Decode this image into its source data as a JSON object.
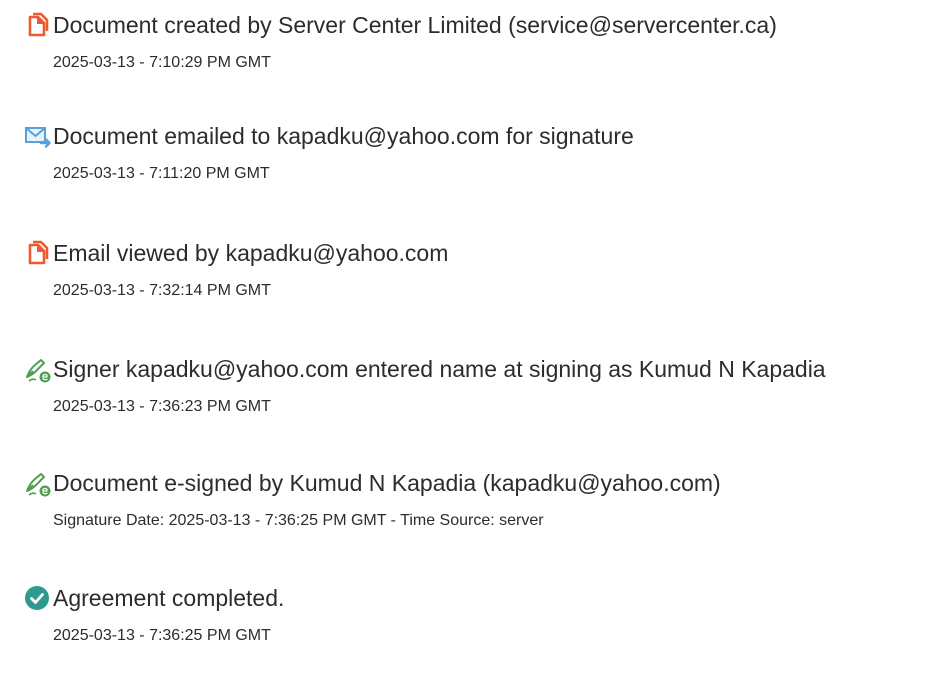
{
  "events": [
    {
      "icon": "document-created-icon",
      "title": "Document created by Server Center Limited (service@servercenter.ca)",
      "meta": "2025-03-13 - 7:10:29 PM GMT"
    },
    {
      "icon": "email-sent-icon",
      "title": "Document emailed to kapadku@yahoo.com for signature",
      "meta": "2025-03-13 - 7:11:20 PM GMT"
    },
    {
      "icon": "email-viewed-icon",
      "title": "Email viewed by kapadku@yahoo.com",
      "meta": "2025-03-13 - 7:32:14 PM GMT"
    },
    {
      "icon": "signer-name-icon",
      "title": "Signer kapadku@yahoo.com entered name at signing as Kumud N Kapadia",
      "meta": "2025-03-13 - 7:36:23 PM GMT"
    },
    {
      "icon": "e-signed-icon",
      "title": "Document e-signed by Kumud N Kapadia (kapadku@yahoo.com)",
      "meta": "Signature Date: 2025-03-13 - 7:36:25 PM GMT - Time Source: server"
    },
    {
      "icon": "agreement-completed-icon",
      "title": "Agreement completed.",
      "meta": "2025-03-13 - 7:36:25 PM GMT"
    }
  ],
  "colors": {
    "doc_orange": "#ec5b2f",
    "mail_blue": "#5a9fdc",
    "pen_green": "#4e9f4f",
    "check_teal": "#2e9a8e"
  }
}
